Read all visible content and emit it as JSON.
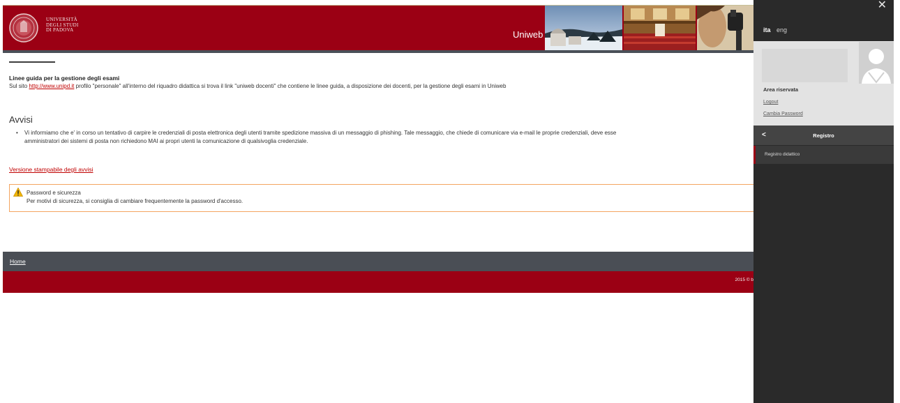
{
  "header": {
    "logo_lines": [
      "Università",
      "degli Studi",
      "di Padova"
    ],
    "brand": "Uniweb",
    "photos": [
      "observatory-photo",
      "hall-photo",
      "microscope-photo"
    ]
  },
  "main": {
    "guide": {
      "title": "Linee guida per la gestione degli esami",
      "text_prefix": "Sul sito ",
      "link": "http://www.unipd.it",
      "text_suffix": " profilo \"personale\" all'interno del riquadro didattica si trova il link \"uniweb docenti\" che contiene le linee guida, a disposizione dei docenti, per la gestione degli esami in Uniweb"
    },
    "avvisi": {
      "title": "Avvisi",
      "item_line1": "Vi informiamo che e' in corso un tentativo di carpire le credenziali di posta elettronica degli utenti tramite spedizione massiva di un messaggio di phishing. Tale messaggio, che chiede di comunicare via e-mail le proprie credenziali, deve esse",
      "item_line2": "amministratori dei sistemi di posta non richiedono MAI ai propri utenti la comunicazione di qualsivoglia credenziale."
    },
    "print_link": "Versione stampabile degli avvisi",
    "alert": {
      "icon": "warning-icon",
      "title": "Password e sicurezza",
      "text": "Per motivi di sicurezza, si consiglia di cambiare frequentemente la password d'accesso."
    }
  },
  "footer": {
    "home": "Home",
    "copyright": "2015 © b"
  },
  "panel": {
    "close": "✕",
    "lang_active": "ita",
    "lang_other": "eng",
    "area_label": "Area riservata",
    "logout": "Logout",
    "change_password": "Cambia Password",
    "section_title": "Registro",
    "section_item": "Registro didattico"
  },
  "colors": {
    "brand_red": "#9b0014",
    "footer_gray": "#4a4e55",
    "panel_dark": "#2a2a2a",
    "alert_border": "#f4a460",
    "link_red": "#c00000"
  }
}
